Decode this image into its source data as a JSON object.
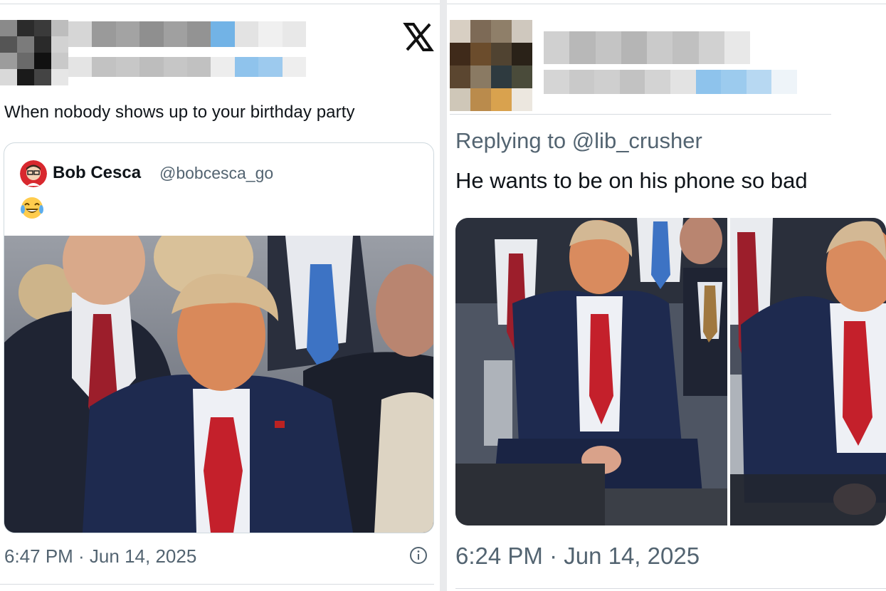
{
  "left_tweet": {
    "platform_icon": "x-logo-icon",
    "text": "When nobody shows up to your birthday party",
    "quoted": {
      "name": "Bob Cesca",
      "handle": "@bobcesca_go",
      "emoji": "😂"
    },
    "timestamp": "6:47 PM · Jun 14, 2025",
    "info_icon": "info-icon"
  },
  "right_tweet": {
    "reply_context": "Replying to @lib_crusher",
    "text": "He wants to be on his phone so bad",
    "timestamp": "6:24 PM · Jun 14, 2025"
  },
  "colors": {
    "text_primary": "#0f1419",
    "text_secondary": "#536471",
    "border": "#cfd9de",
    "tie_red": "#c4202b",
    "suit_navy": "#1e2a4f"
  }
}
